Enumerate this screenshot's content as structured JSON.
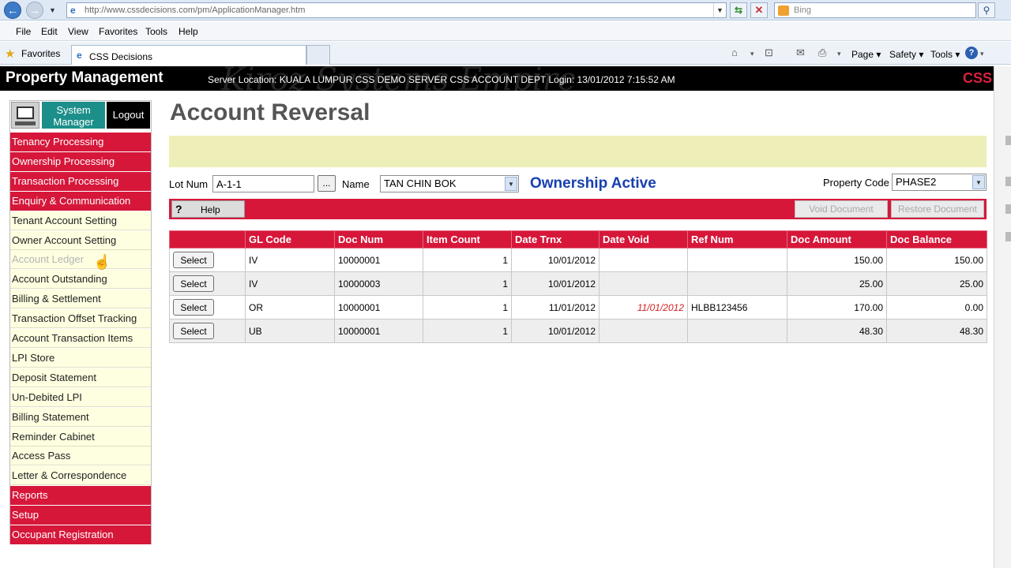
{
  "browser": {
    "url": "http://www.cssdecisions.com/pm/ApplicationManager.htm",
    "search_placeholder": "Bing",
    "menu": [
      "File",
      "Edit",
      "View",
      "Favorites",
      "Tools",
      "Help"
    ],
    "favorites_label": "Favorites",
    "tab_title": "CSS Decisions",
    "commands": {
      "page": "Page ▾",
      "safety": "Safety ▾",
      "tools": "Tools ▾"
    }
  },
  "app": {
    "title": "Property Management",
    "server_info": "Server Location: KUALA LUMPUR  CSS DEMO SERVER  CSS ACCOUNT DEPT  Login: 13/01/2012 7:15:52 AM",
    "brand": "CSS",
    "watermark": "Kiroz Systems Empire"
  },
  "sidebar": {
    "system_manager": "System Manager",
    "logout": "Logout",
    "items": [
      {
        "label": "Tenancy Processing",
        "style": "red"
      },
      {
        "label": "Ownership Processing",
        "style": "red"
      },
      {
        "label": "Transaction Processing",
        "style": "red"
      },
      {
        "label": "Enquiry & Communication",
        "style": "red"
      },
      {
        "label": "Tenant Account Setting",
        "style": "light"
      },
      {
        "label": "Owner Account Setting",
        "style": "light"
      },
      {
        "label": "Account Ledger",
        "style": "disabled"
      },
      {
        "label": "Account Outstanding",
        "style": "light"
      },
      {
        "label": "Billing & Settlement",
        "style": "light"
      },
      {
        "label": "Transaction Offset Tracking",
        "style": "light"
      },
      {
        "label": "Account Transaction Items",
        "style": "light"
      },
      {
        "label": "LPI Store",
        "style": "light"
      },
      {
        "label": "Deposit Statement",
        "style": "light"
      },
      {
        "label": "Un-Debited LPI",
        "style": "light"
      },
      {
        "label": "Billing Statement",
        "style": "light"
      },
      {
        "label": "Reminder Cabinet",
        "style": "light"
      },
      {
        "label": "Access Pass",
        "style": "light"
      },
      {
        "label": "Letter & Correspondence",
        "style": "light"
      },
      {
        "label": "Reports",
        "style": "red"
      },
      {
        "label": "Setup",
        "style": "red"
      },
      {
        "label": "Occupant Registration",
        "style": "red"
      }
    ]
  },
  "main": {
    "title": "Account Reversal",
    "lot_label": "Lot Num",
    "lot_value": "A-1-1",
    "lookup_btn": "...",
    "name_label": "Name",
    "name_value": "TAN CHIN BOK",
    "status": "Ownership Active",
    "property_label": "Property Code",
    "property_value": "PHASE2",
    "help_btn": "Help",
    "void_btn": "Void Document",
    "restore_btn": "Restore Document"
  },
  "table": {
    "headers": [
      "",
      "GL Code",
      "Doc Num",
      "Item Count",
      "Date Trnx",
      "Date Void",
      "Ref Num",
      "Doc Amount",
      "Doc Balance"
    ],
    "select_label": "Select",
    "rows": [
      {
        "gl": "IV",
        "doc": "10000001",
        "count": "1",
        "trnx": "10/01/2012",
        "void": "",
        "ref": "",
        "amount": "150.00",
        "balance": "150.00"
      },
      {
        "gl": "IV",
        "doc": "10000003",
        "count": "1",
        "trnx": "10/01/2012",
        "void": "",
        "ref": "",
        "amount": "25.00",
        "balance": "25.00"
      },
      {
        "gl": "OR",
        "doc": "10000001",
        "count": "1",
        "trnx": "11/01/2012",
        "void": "11/01/2012",
        "ref": "HLBB123456",
        "amount": "170.00",
        "balance": "0.00"
      },
      {
        "gl": "UB",
        "doc": "10000001",
        "count": "1",
        "trnx": "10/01/2012",
        "void": "",
        "ref": "",
        "amount": "48.30",
        "balance": "48.30"
      }
    ]
  }
}
